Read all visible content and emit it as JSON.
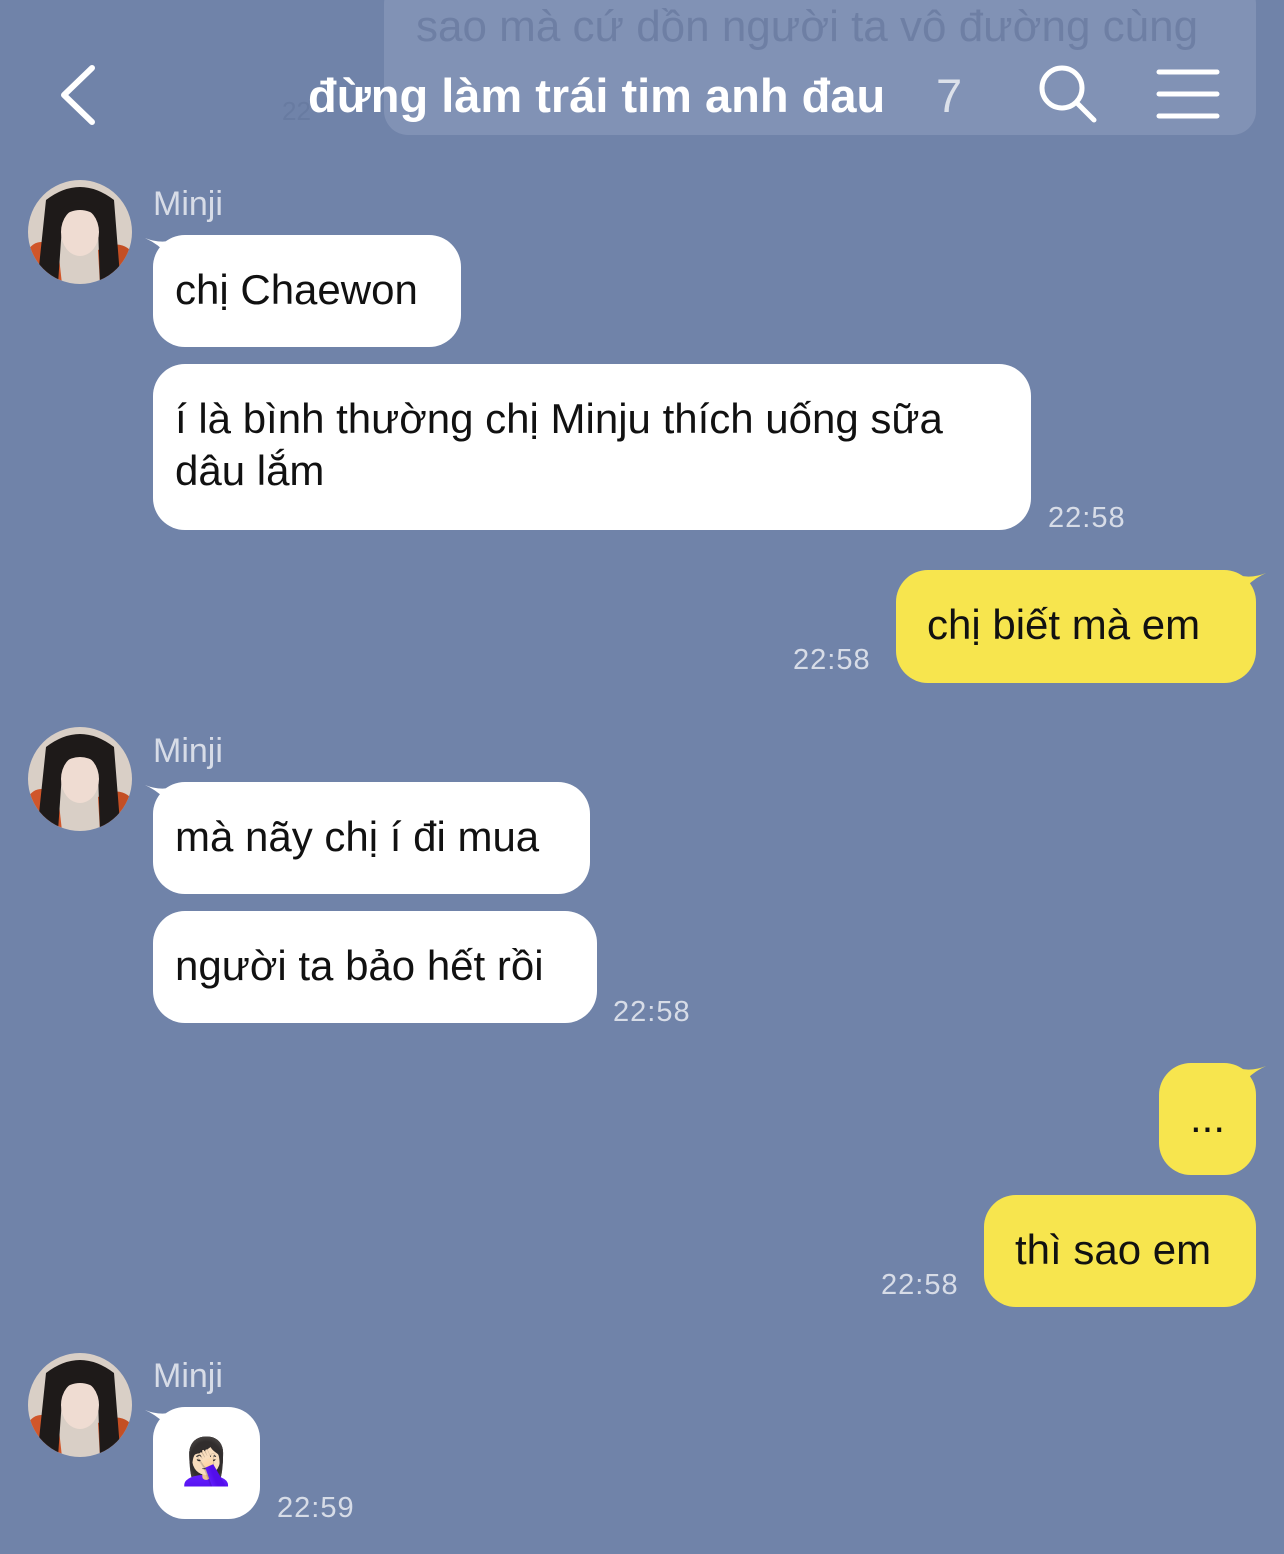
{
  "background_banner": {
    "text": "sao mà cứ dồn người ta vô đường cùng",
    "time": "22"
  },
  "header": {
    "title": "đừng làm trái tim anh đau",
    "member_count": "7",
    "icons": [
      "back-chevron-icon",
      "search-icon",
      "menu-icon"
    ]
  },
  "colors": {
    "background": "#7083a9",
    "incoming_bubble": "#ffffff",
    "outgoing_bubble": "#f7e54e"
  },
  "messages": [
    {
      "sender": "Minji",
      "texts": [
        "chị Chaewon",
        "í là bình thường chị Minju thích uống sữa dâu lắm"
      ],
      "time": "22:58"
    },
    {
      "sender": "me",
      "texts": [
        "chị biết mà em"
      ],
      "time": "22:58"
    },
    {
      "sender": "Minji",
      "texts": [
        "mà nãy chị í đi mua",
        "người ta bảo hết rồi"
      ],
      "time": "22:58"
    },
    {
      "sender": "me",
      "texts": [
        "...",
        "thì sao em"
      ],
      "time": "22:58"
    },
    {
      "sender": "Minji",
      "texts": [
        "🤦🏻‍♀️"
      ],
      "time": "22:59"
    }
  ]
}
